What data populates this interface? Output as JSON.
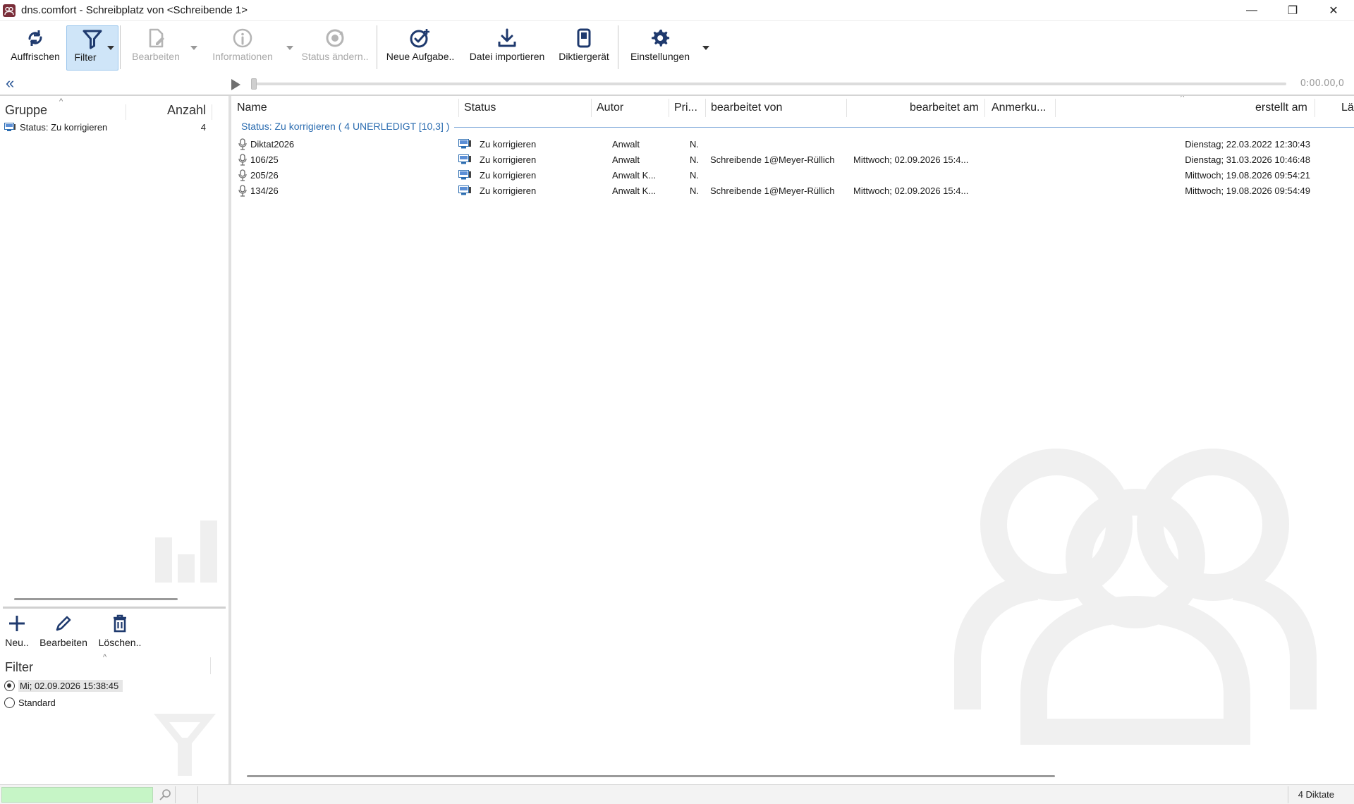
{
  "window": {
    "title": "dns.comfort - Schreibplatz von <Schreibende 1>",
    "minimize": "—",
    "restore": "❐",
    "close": "✕"
  },
  "toolbar": {
    "refresh": "Auffrischen",
    "filter": "Filter",
    "edit": "Bearbeiten",
    "info": "Informationen",
    "change_status": "Status ändern..",
    "new_task": "Neue Aufgabe..",
    "import_file": "Datei importieren",
    "dictation_device": "Diktiergerät",
    "settings": "Einstellungen"
  },
  "player": {
    "collapse": "«",
    "time": "0:00.00,0"
  },
  "groups": {
    "header_group": "Gruppe",
    "header_count": "Anzahl",
    "rows": [
      {
        "label": "Status: Zu korrigieren",
        "count": "4"
      }
    ]
  },
  "filter_toolbar": {
    "new": "Neu..",
    "edit": "Bearbeiten",
    "delete": "Löschen.."
  },
  "filters": {
    "header": "Filter",
    "items": [
      {
        "label": "Mi; 02.09.2026 15:38:45",
        "selected": true
      },
      {
        "label": "Standard",
        "selected": false
      }
    ]
  },
  "list": {
    "columns": [
      "Name",
      "Status",
      "Autor",
      "Pri...",
      "bearbeitet von",
      "bearbeitet am",
      "Anmerku...",
      "erstellt am",
      "Lä"
    ],
    "group_caption": "Status: Zu korrigieren ( 4 UNERLEDIGT [10,3] )",
    "rows": [
      {
        "name": "Diktat2026",
        "status": "Zu korrigieren",
        "author": "Anwalt",
        "priority": "N.",
        "edited_by": "",
        "edited_on": "",
        "note": "",
        "created": "Dienstag; 22.03.2022 12:30:43"
      },
      {
        "name": "106/25",
        "status": "Zu korrigieren",
        "author": "Anwalt",
        "priority": "N.",
        "edited_by": "Schreibende 1@Meyer-Rüllich",
        "edited_on": "Mittwoch; 02.09.2026 15:4...",
        "note": "",
        "created": "Dienstag; 31.03.2026 10:46:48"
      },
      {
        "name": "205/26",
        "status": "Zu korrigieren",
        "author": "Anwalt K...",
        "priority": "N.",
        "edited_by": "",
        "edited_on": "",
        "note": "",
        "created": "Mittwoch; 19.08.2026 09:54:21"
      },
      {
        "name": "134/26",
        "status": "Zu korrigieren",
        "author": "Anwalt K...",
        "priority": "N.",
        "edited_by": "Schreibende 1@Meyer-Rüllich",
        "edited_on": "Mittwoch; 02.09.2026 15:4...",
        "note": "",
        "created": "Mittwoch; 19.08.2026 09:54:49"
      }
    ]
  },
  "statusbar": {
    "count": "4 Diktate"
  },
  "colors": {
    "accent": "#2b6cb0",
    "active_button": "#cfe5f8",
    "search_field": "#c6f5c6",
    "icon_dark": "#1f3a6e"
  }
}
